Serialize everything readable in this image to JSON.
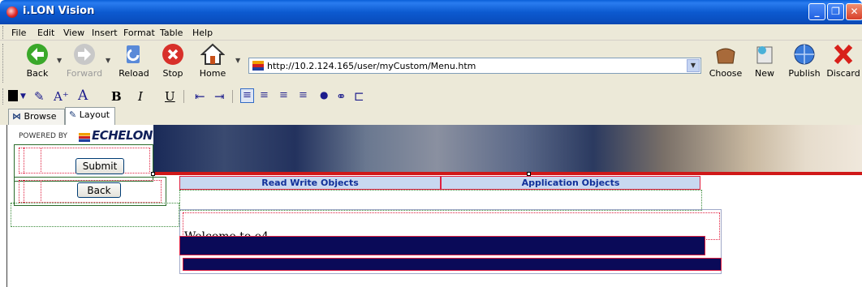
{
  "window": {
    "title": "i.LON Vision",
    "minimize": "_",
    "maximize": "❐",
    "close": "✕"
  },
  "menu": [
    "File",
    "Edit",
    "View",
    "Insert",
    "Format",
    "Table",
    "Help"
  ],
  "toolbar": {
    "back": "Back",
    "forward": "Forward",
    "reload": "Reload",
    "stop": "Stop",
    "home": "Home",
    "choose": "Choose",
    "new": "New",
    "publish": "Publish",
    "discard": "Discard"
  },
  "address": {
    "url": "http://10.2.124.165/user/myCustom/Menu.htm"
  },
  "format": {
    "bold": "B",
    "italic": "I",
    "underline": "U"
  },
  "tabs": {
    "browse": "Browse",
    "layout": "Layout"
  },
  "page": {
    "powered_by": "POWERED BY",
    "brand": "ECHELON",
    "submit_button": "Submit",
    "back_button": "Back",
    "header_read_write": "Read Write Objects",
    "header_application": "Application Objects",
    "welcome": "Welcome to e4"
  },
  "colors": {
    "titlebar": "#0a5fd8",
    "table_header_bg": "#c8d8f0",
    "table_header_text": "#10309a",
    "navy_bar": "#0a0a58",
    "banner_red": "#d01818"
  }
}
